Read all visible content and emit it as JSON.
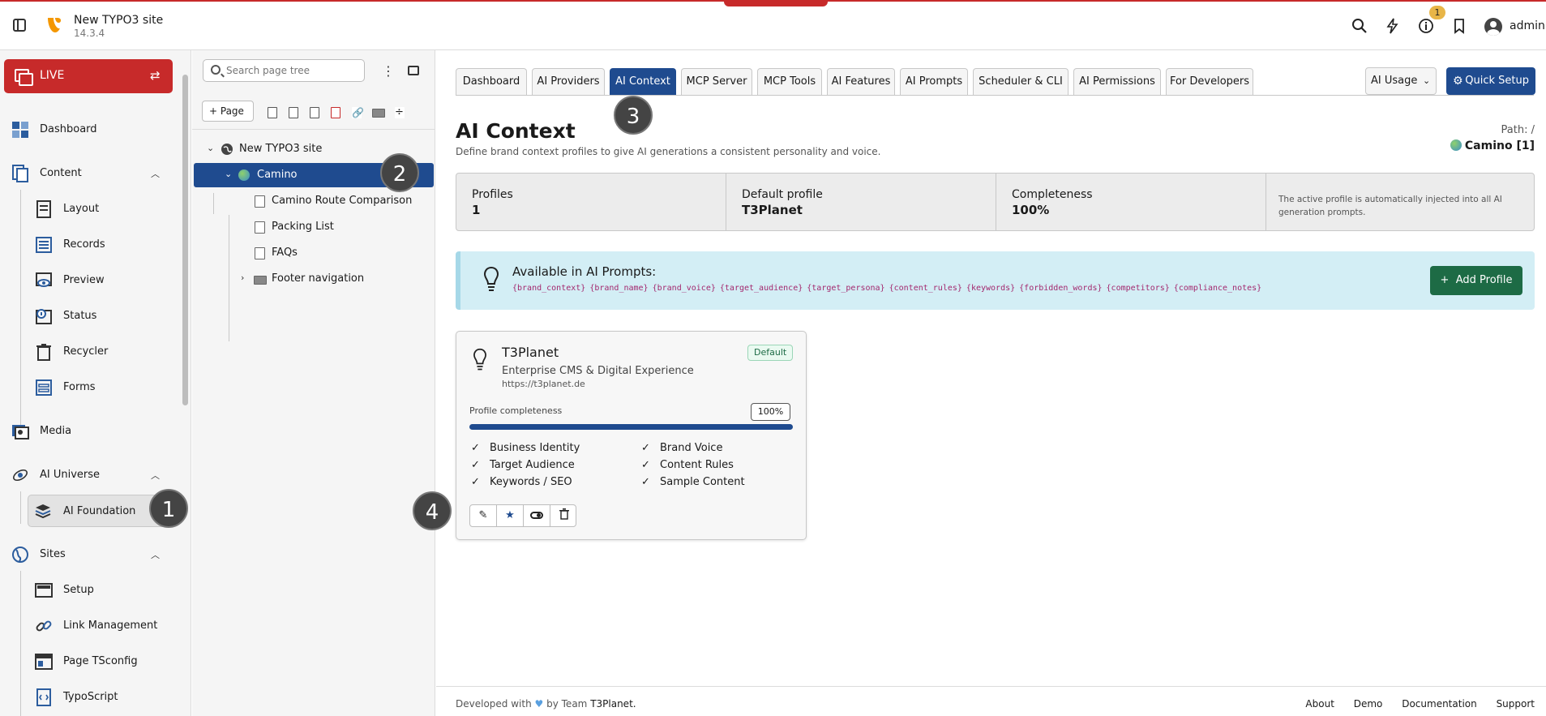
{
  "topbar": {
    "site_name": "New TYPO3 site",
    "version": "14.3.4",
    "notification_count": "1",
    "username": "admin",
    "accent_color": "#c72a2a"
  },
  "modules": {
    "live_label": "LIVE",
    "items": [
      {
        "label": "Dashboard",
        "icon": "dashboard-icon"
      },
      {
        "label": "Content",
        "icon": "content-icon"
      },
      {
        "label": "Layout",
        "icon": "layout-icon"
      },
      {
        "label": "Records",
        "icon": "records-icon"
      },
      {
        "label": "Preview",
        "icon": "preview-icon"
      },
      {
        "label": "Status",
        "icon": "status-icon"
      },
      {
        "label": "Recycler",
        "icon": "recycler-icon"
      },
      {
        "label": "Forms",
        "icon": "forms-icon"
      },
      {
        "label": "Media",
        "icon": "media-icon"
      },
      {
        "label": "AI Universe",
        "icon": "ai-universe-icon"
      },
      {
        "label": "AI Foundation",
        "icon": "ai-foundation-icon"
      },
      {
        "label": "Sites",
        "icon": "sites-icon"
      },
      {
        "label": "Setup",
        "icon": "setup-icon"
      },
      {
        "label": "Link Management",
        "icon": "link-icon"
      },
      {
        "label": "Page TSconfig",
        "icon": "tsconfig-icon"
      },
      {
        "label": "TypoScript",
        "icon": "typoscript-icon"
      }
    ]
  },
  "annotations": [
    "1",
    "2",
    "3",
    "4"
  ],
  "tree": {
    "search_placeholder": "Search page tree",
    "page_button": "Page",
    "nodes": [
      {
        "label": "New TYPO3 site"
      },
      {
        "label": "Camino"
      },
      {
        "label": "Camino Route Comparison"
      },
      {
        "label": "Packing List"
      },
      {
        "label": "FAQs"
      },
      {
        "label": "Footer navigation"
      }
    ]
  },
  "tabs": [
    {
      "label": "Dashboard"
    },
    {
      "label": "AI Providers"
    },
    {
      "label": "AI Context"
    },
    {
      "label": "MCP Server"
    },
    {
      "label": "MCP Tools"
    },
    {
      "label": "AI Features"
    },
    {
      "label": "AI Prompts"
    },
    {
      "label": "Scheduler & CLI"
    },
    {
      "label": "AI Permissions"
    },
    {
      "label": "For Developers"
    }
  ],
  "header_actions": {
    "usage_label": "AI Usage",
    "quick_setup_label": "Quick Setup"
  },
  "page": {
    "title": "AI Context",
    "subtitle": "Define brand context profiles to give AI generations a consistent personality and voice.",
    "path_label": "Path: /",
    "path_value": "Camino [1]"
  },
  "stats": [
    {
      "label": "Profiles",
      "value": "1"
    },
    {
      "label": "Default profile",
      "value": "T3Planet"
    },
    {
      "label": "Completeness",
      "value": "100%"
    }
  ],
  "stats_note": "The active profile is automatically injected into all AI generation prompts.",
  "info": {
    "title": "Available in AI Prompts:",
    "variables": "{brand_context} {brand_name} {brand_voice} {target_audience} {target_persona} {content_rules} {keywords} {forbidden_words} {competitors} {compliance_notes}",
    "add_button": "Add Profile"
  },
  "profile_card": {
    "name": "T3Planet",
    "badge": "Default",
    "tagline": "Enterprise CMS & Digital Experience",
    "url": "https://t3planet.de",
    "completeness_label": "Profile completeness",
    "completeness_value": "100%",
    "completeness_fraction": 1.0,
    "checks": [
      "Business Identity",
      "Brand Voice",
      "Target Audience",
      "Content Rules",
      "Keywords / SEO",
      "Sample Content"
    ]
  },
  "footer": {
    "developed_prefix": "Developed with",
    "developed_by": "by Team",
    "team": "T3Planet.",
    "links": [
      "About",
      "Demo",
      "Documentation",
      "Support"
    ]
  }
}
